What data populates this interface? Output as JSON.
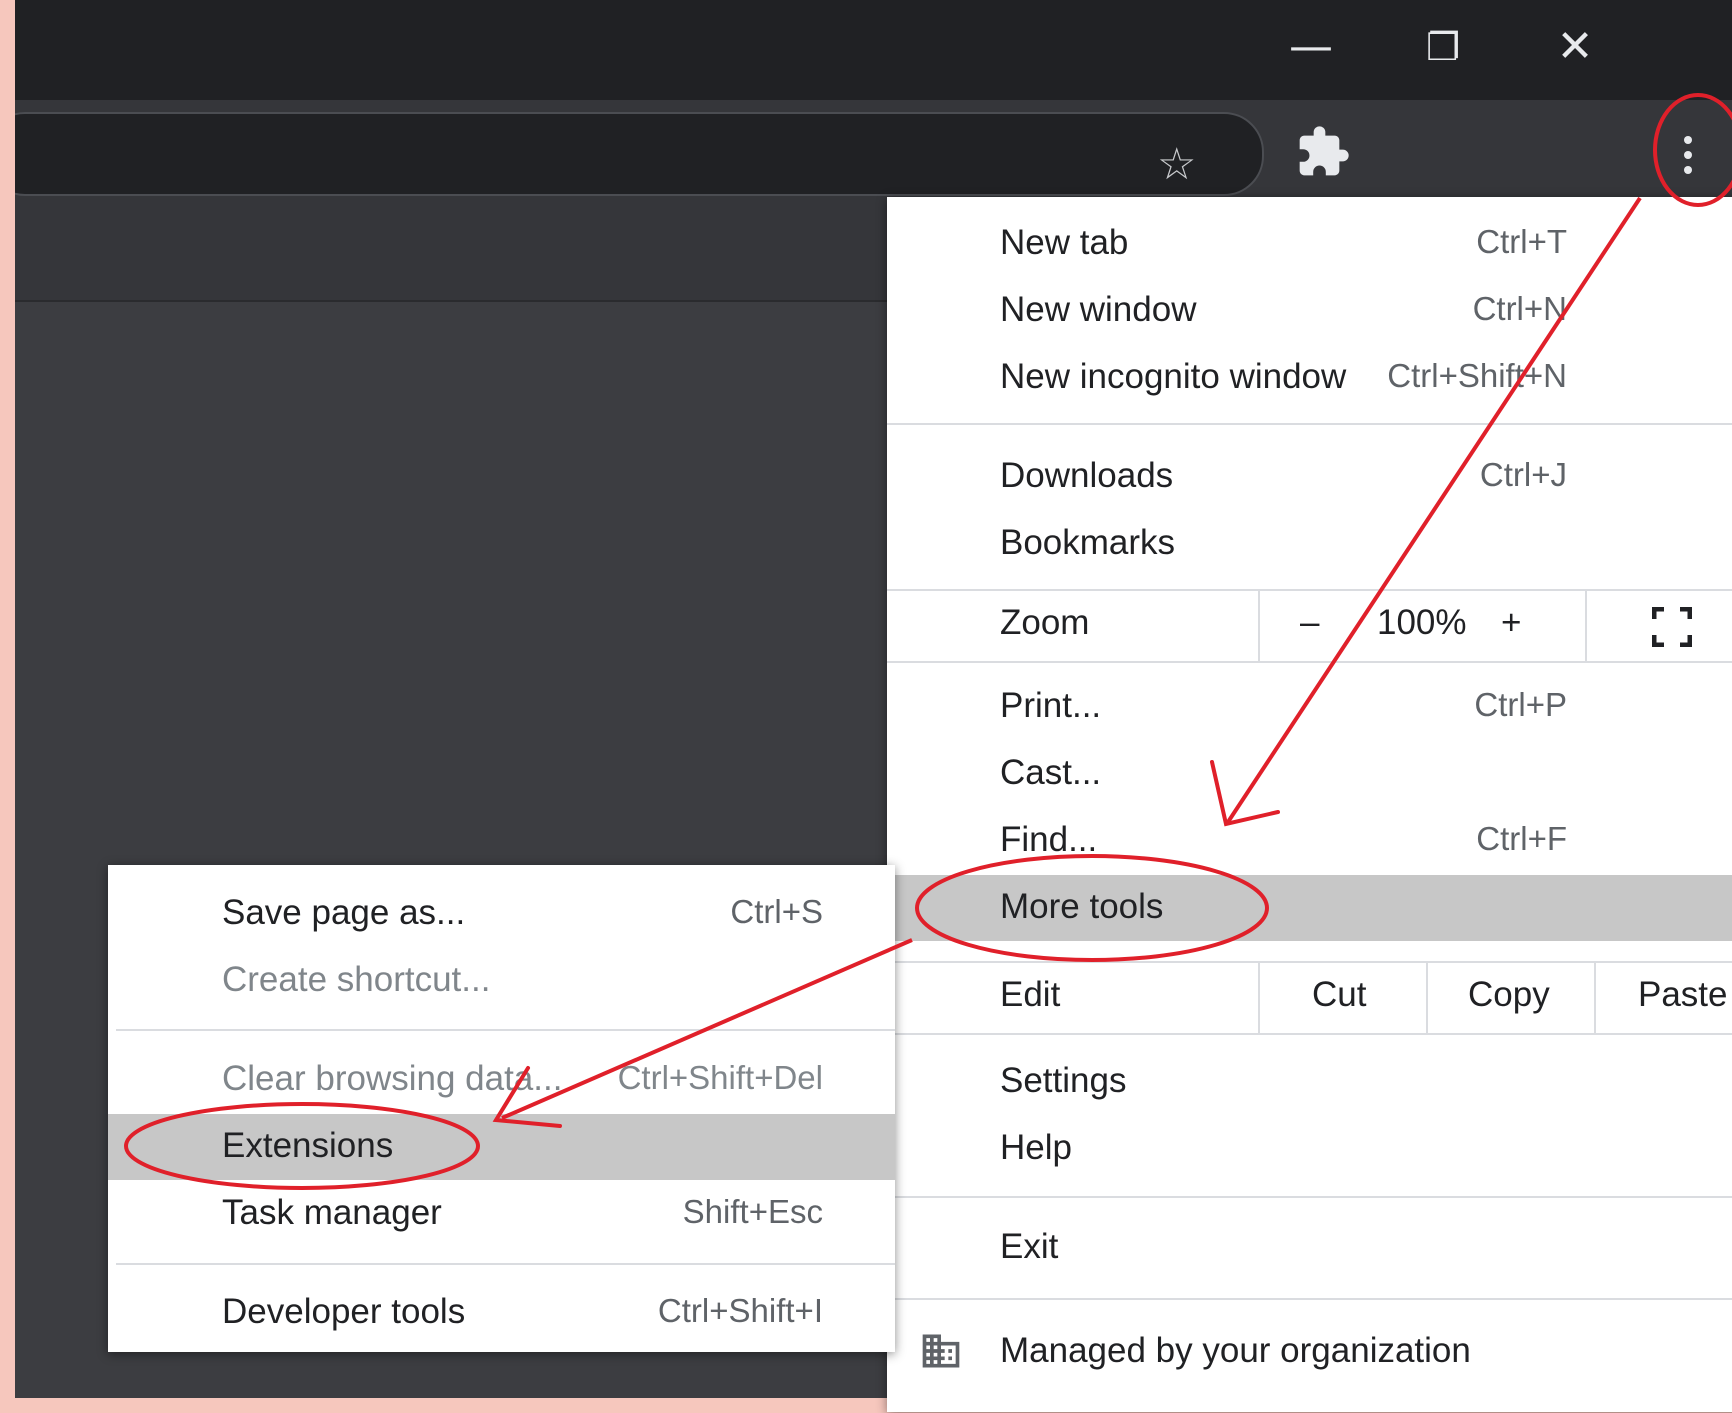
{
  "window_controls": {
    "minimize": "—",
    "restore": "❐",
    "close": "✕"
  },
  "toolbar": {
    "star_icon": "☆"
  },
  "main_menu": {
    "new_tab": {
      "label": "New tab",
      "shortcut": "Ctrl+T"
    },
    "new_window": {
      "label": "New window",
      "shortcut": "Ctrl+N"
    },
    "new_incognito": {
      "label": "New incognito window",
      "shortcut": "Ctrl+Shift+N"
    },
    "downloads": {
      "label": "Downloads",
      "shortcut": "Ctrl+J"
    },
    "bookmarks": {
      "label": "Bookmarks"
    },
    "zoom": {
      "label": "Zoom",
      "minus": "–",
      "level": "100%",
      "plus": "+"
    },
    "print": {
      "label": "Print...",
      "shortcut": "Ctrl+P"
    },
    "cast": {
      "label": "Cast..."
    },
    "find": {
      "label": "Find...",
      "shortcut": "Ctrl+F"
    },
    "more_tools": {
      "label": "More tools"
    },
    "edit": {
      "label": "Edit",
      "cut": "Cut",
      "copy": "Copy",
      "paste": "Paste"
    },
    "settings": {
      "label": "Settings"
    },
    "help": {
      "label": "Help"
    },
    "exit": {
      "label": "Exit"
    },
    "managed": {
      "label": "Managed by your organization"
    }
  },
  "more_tools_menu": {
    "save_page": {
      "label": "Save page as...",
      "shortcut": "Ctrl+S"
    },
    "create_shortcut": {
      "label": "Create shortcut..."
    },
    "clear_data": {
      "label": "Clear browsing data...",
      "shortcut": "Ctrl+Shift+Del"
    },
    "extensions": {
      "label": "Extensions"
    },
    "task_manager": {
      "label": "Task manager",
      "shortcut": "Shift+Esc"
    },
    "developer_tools": {
      "label": "Developer tools",
      "shortcut": "Ctrl+Shift+I"
    }
  },
  "annotation_color": "#e0202a",
  "highlight_color": "#c7c7c7"
}
